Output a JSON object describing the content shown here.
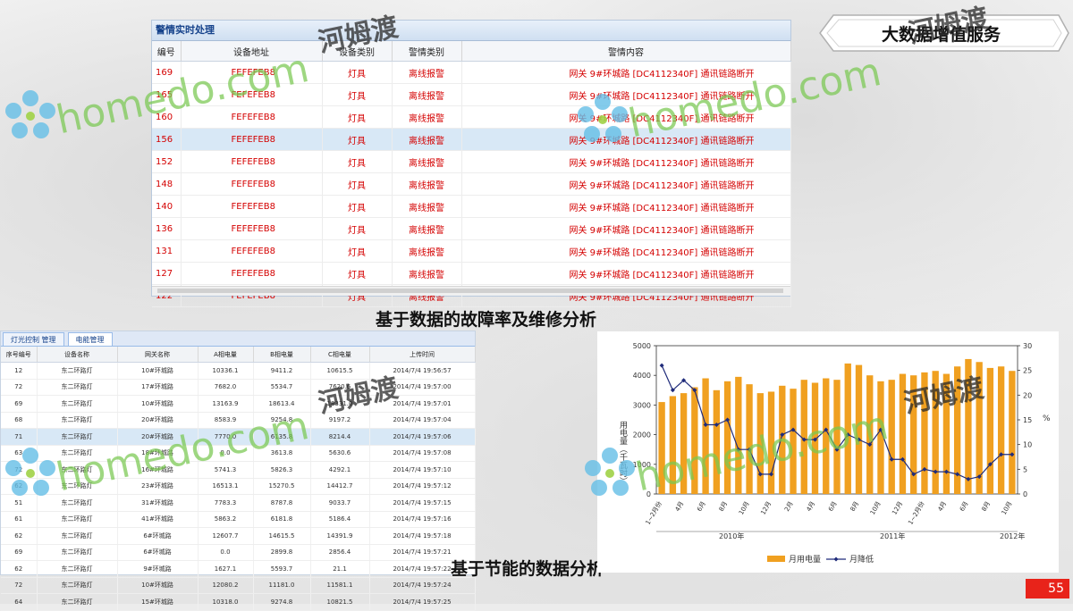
{
  "header": {
    "title": "大数据增值服务"
  },
  "alarm_panel": {
    "title": "警情实时处理",
    "columns": [
      "编号",
      "设备地址",
      "设备类别",
      "警情类别",
      "警情内容"
    ],
    "rows": [
      [
        "169",
        "FEFEFEB8",
        "灯具",
        "离线报警",
        "网关 9#环城路 [DC4112340F] 通讯链路断开"
      ],
      [
        "165",
        "FEFEFEB8",
        "灯具",
        "离线报警",
        "网关 9#环城路 [DC4112340F] 通讯链路断开"
      ],
      [
        "160",
        "FEFEFEB8",
        "灯具",
        "离线报警",
        "网关 9#环城路 [DC4112340F] 通讯链路断开"
      ],
      [
        "156",
        "FEFEFEB8",
        "灯具",
        "离线报警",
        "网关 9#环城路 [DC4112340F] 通讯链路断开"
      ],
      [
        "152",
        "FEFEFEB8",
        "灯具",
        "离线报警",
        "网关 9#环城路 [DC4112340F] 通讯链路断开"
      ],
      [
        "148",
        "FEFEFEB8",
        "灯具",
        "离线报警",
        "网关 9#环城路 [DC4112340F] 通讯链路断开"
      ],
      [
        "140",
        "FEFEFEB8",
        "灯具",
        "离线报警",
        "网关 9#环城路 [DC4112340F] 通讯链路断开"
      ],
      [
        "136",
        "FEFEFEB8",
        "灯具",
        "离线报警",
        "网关 9#环城路 [DC4112340F] 通讯链路断开"
      ],
      [
        "131",
        "FEFEFEB8",
        "灯具",
        "离线报警",
        "网关 9#环城路 [DC4112340F] 通讯链路断开"
      ],
      [
        "127",
        "FEFEFEB8",
        "灯具",
        "离线报警",
        "网关 9#环城路 [DC4112340F] 通讯链路断开"
      ],
      [
        "122",
        "FEFEFEB8",
        "灯具",
        "离线报警",
        "网关 9#环城路 [DC4112340F] 通讯链路断开"
      ]
    ],
    "selected_row": 3
  },
  "caption_fault": "基于数据的故障率及维修分析",
  "energy_panel": {
    "tabs": [
      "灯光控制 管理",
      "电能管理"
    ],
    "active_tab": 1,
    "columns": [
      "序号编号",
      "设备名称",
      "网关名称",
      "A相电量",
      "B相电量",
      "C相电量",
      "上传时间"
    ],
    "rows": [
      [
        "12",
        "东二环路灯",
        "10#环城路",
        "10336.1",
        "9411.2",
        "10615.5",
        "2014/7/4 19:56:57"
      ],
      [
        "72",
        "东二环路灯",
        "17#环城路",
        "7682.0",
        "5534.7",
        "7620.6",
        "2014/7/4 19:57:00"
      ],
      [
        "69",
        "东二环路灯",
        "10#环城路",
        "13163.9",
        "18613.4",
        "18331.0",
        "2014/7/4 19:57:01"
      ],
      [
        "68",
        "东二环路灯",
        "20#环城路",
        "8583.9",
        "9254.8",
        "9197.2",
        "2014/7/4 19:57:04"
      ],
      [
        "71",
        "东二环路灯",
        "20#环城路",
        "7770.0",
        "6135.8",
        "8214.4",
        "2014/7/4 19:57:06"
      ],
      [
        "63",
        "东二环路灯",
        "18#环城路",
        "0.0",
        "3613.8",
        "5630.6",
        "2014/7/4 19:57:08"
      ],
      [
        "72",
        "东二环路灯",
        "16#环城路",
        "5741.3",
        "5826.3",
        "4292.1",
        "2014/7/4 19:57:10"
      ],
      [
        "62",
        "东二环路灯",
        "23#环城路",
        "16513.1",
        "15270.5",
        "14412.7",
        "2014/7/4 19:57:12"
      ],
      [
        "51",
        "东二环路灯",
        "31#环城路",
        "7783.3",
        "8787.8",
        "9033.7",
        "2014/7/4 19:57:15"
      ],
      [
        "61",
        "东二环路灯",
        "41#环城路",
        "5863.2",
        "6181.8",
        "5186.4",
        "2014/7/4 19:57:16"
      ],
      [
        "62",
        "东二环路灯",
        "6#环城路",
        "12607.7",
        "14615.5",
        "14391.9",
        "2014/7/4 19:57:18"
      ],
      [
        "69",
        "东二环路灯",
        "6#环城路",
        "0.0",
        "2899.8",
        "2856.4",
        "2014/7/4 19:57:21"
      ],
      [
        "62",
        "东二环路灯",
        "9#环城路",
        "1627.1",
        "5593.7",
        "21.1",
        "2014/7/4 19:57:22"
      ],
      [
        "72",
        "东二环路灯",
        "10#环城路",
        "12080.2",
        "11181.0",
        "11581.1",
        "2014/7/4 19:57:24"
      ],
      [
        "64",
        "东二环路灯",
        "15#环城路",
        "10318.0",
        "9274.8",
        "10821.5",
        "2014/7/4 19:57:25"
      ]
    ],
    "selected_row": 4
  },
  "caption_energy": "基于节能的数据分析",
  "chart_data": {
    "type": "bar",
    "categories": [
      "1~2月份",
      "3月",
      "4月",
      "5月",
      "6月",
      "7月",
      "8月",
      "9月",
      "10月",
      "11月",
      "12月",
      "1~2月份",
      "3月",
      "4月",
      "5月",
      "6月",
      "7月",
      "8月",
      "9月",
      "10月",
      "11月",
      "12月",
      "1~2月份",
      "3月",
      "4月",
      "5月",
      "6月",
      "7月",
      "8月",
      "9月",
      "10月",
      "11月",
      "12月"
    ],
    "x_tick_labels": [
      "1~2月份",
      "4月",
      "6月",
      "8月",
      "10月",
      "12月",
      "2月",
      "4月",
      "6月",
      "8月",
      "10月",
      "12月",
      "1~2月份",
      "4月",
      "6月",
      "8月",
      "10月"
    ],
    "year_labels": [
      "2010年",
      "2011年",
      "2012年"
    ],
    "series": [
      {
        "name": "月用电量",
        "axis": "left",
        "type": "bar",
        "color": "#f0a020",
        "values": [
          3100,
          3300,
          3400,
          3600,
          3900,
          3500,
          3800,
          3950,
          3700,
          3400,
          3450,
          3650,
          3550,
          3850,
          3750,
          3900,
          3850,
          4400,
          4350,
          4000,
          3800,
          3850,
          4050,
          4000,
          4100,
          4150,
          4050,
          4300,
          4550,
          4450,
          4250,
          4300,
          4150
        ]
      },
      {
        "name": "月降低",
        "axis": "right",
        "type": "line",
        "color": "#1f2b7a",
        "values": [
          26,
          21,
          23,
          21,
          14,
          14,
          15,
          9,
          9,
          4,
          4,
          12,
          13,
          11,
          11,
          13,
          9,
          12,
          11,
          10,
          13,
          7,
          7,
          4,
          5,
          4.5,
          4.5,
          4,
          3,
          3.5,
          6,
          8,
          8
        ]
      }
    ],
    "ylim_left": [
      0,
      5000
    ],
    "ylim_right": [
      0,
      30
    ],
    "left_ticks": [
      0,
      1000,
      2000,
      3000,
      4000,
      5000
    ],
    "right_ticks": [
      0,
      5,
      10,
      15,
      20,
      25,
      30
    ],
    "ylabel_left": "用电量（千瓦时）",
    "ylabel_right": "%",
    "legend_position": "bottom"
  },
  "page_number": "55",
  "watermark": {
    "latin": "homedo.com",
    "cn": "河姆渡"
  },
  "colors": {
    "alarm_text": "#d40000",
    "bar": "#f0a020",
    "line": "#1f2b7a",
    "page_badge": "#e8231a",
    "watermark": "#78c850"
  }
}
